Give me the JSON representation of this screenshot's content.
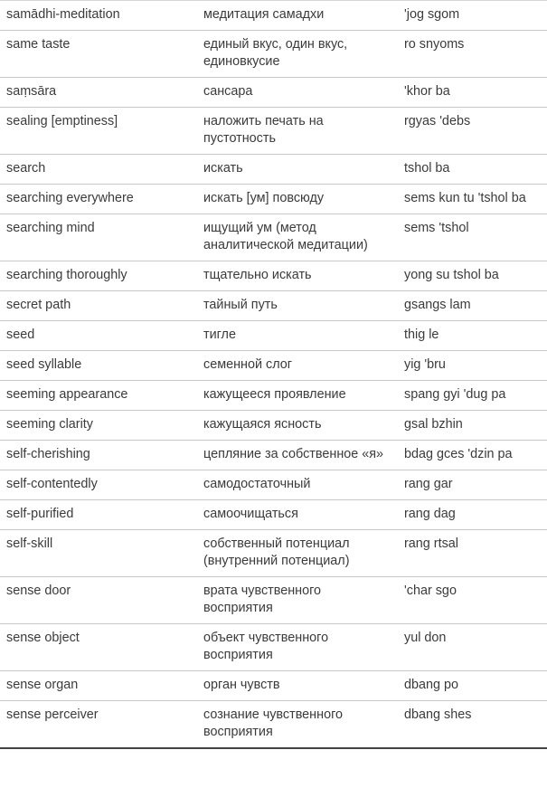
{
  "table": {
    "name": "buddhist-glossary-table",
    "columns": [
      "english_term",
      "russian_translation",
      "tibetan_transliteration"
    ],
    "rows": [
      {
        "term": "samādhi-meditation",
        "ru": "медитация самадхи",
        "tib": "'jog sgom"
      },
      {
        "term": "same taste",
        "ru": "единый вкус, один вкус, единовкусие",
        "tib": "ro snyoms"
      },
      {
        "term": "saṃsāra",
        "ru": "сансара",
        "tib": "'khor ba"
      },
      {
        "term": "sealing [emptiness]",
        "ru": "наложить печать на пустотность",
        "tib": "rgyas 'debs"
      },
      {
        "term": "search",
        "ru": "искать",
        "tib": "tshol ba"
      },
      {
        "term": "searching everywhere",
        "ru": "искать [ум] повсюду",
        "tib": "sems kun tu 'tshol ba"
      },
      {
        "term": "searching mind",
        "ru": "ищущий ум (метод аналитической медитации)",
        "tib": "sems 'tshol"
      },
      {
        "term": "searching thoroughly",
        "ru": "тщательно искать",
        "tib": "yong su tshol ba"
      },
      {
        "term": "secret path",
        "ru": "тайный путь",
        "tib": "gsangs lam"
      },
      {
        "term": "seed",
        "ru": "тигле",
        "tib": "thig le"
      },
      {
        "term": "seed syllable",
        "ru": "семенной слог",
        "tib": "yig 'bru"
      },
      {
        "term": "seeming appearance",
        "ru": "кажущееся проявление",
        "tib": "spang gyi 'dug pa"
      },
      {
        "term": "seeming clarity",
        "ru": "кажущаяся ясность",
        "tib": "gsal bzhin"
      },
      {
        "term": "self-cherishing",
        "ru": "цепляние за собственное «я»",
        "tib": "bdag gces 'dzin pa"
      },
      {
        "term": "self-contentedly",
        "ru": "самодостаточный",
        "tib": "rang gar"
      },
      {
        "term": "self-purified",
        "ru": "самоочищаться",
        "tib": "rang dag"
      },
      {
        "term": "self-skill",
        "ru": "собственный потенциал (внутренний потенциал)",
        "tib": "rang rtsal"
      },
      {
        "term": "sense door",
        "ru": "врата чувственного восприятия",
        "tib": "'char sgo"
      },
      {
        "term": "sense object",
        "ru": "объект чувственного восприятия",
        "tib": "yul don"
      },
      {
        "term": "sense organ",
        "ru": "орган чувств",
        "tib": "dbang po"
      },
      {
        "term": "sense perceiver",
        "ru": "сознание чувственного восприятия",
        "tib": "dbang shes"
      }
    ]
  }
}
